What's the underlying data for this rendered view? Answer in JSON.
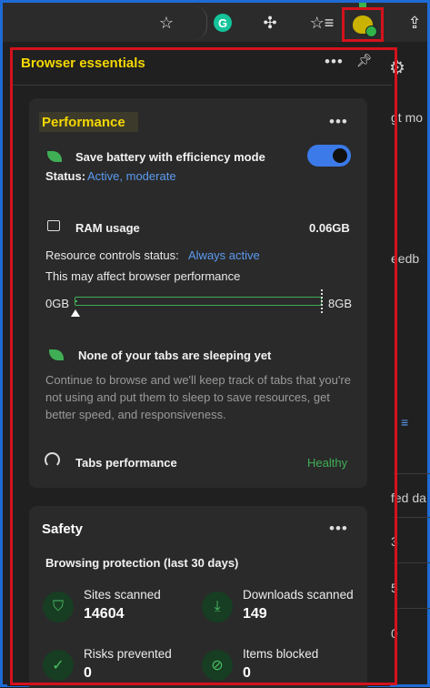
{
  "toolbar": {
    "icons": [
      "star-icon",
      "grammarly-icon",
      "extensions-icon",
      "favorites-icon",
      "browser-essentials-icon",
      "share-icon"
    ],
    "grammarly_letter": "G"
  },
  "background_page": {
    "fragments": [
      "gt mo",
      "eedb",
      "fed da",
      "3",
      "5",
      "0"
    ]
  },
  "panel": {
    "title": "Browser essentials",
    "menu_label": "•••",
    "pin_label": "⚲"
  },
  "performance": {
    "title": "Performance",
    "menu_label": "•••",
    "efficiency_label": "Save battery with efficiency mode",
    "status_label": "Status:",
    "status_value": "Active, moderate",
    "efficiency_toggle_on": true,
    "ram_label": "RAM usage",
    "ram_value": "0.06GB",
    "resource_status_label": "Resource controls status:",
    "resource_status_value": "Always active",
    "affect_text": "This may affect browser performance",
    "bar_min": "0GB",
    "bar_max": "8GB",
    "bar_fraction": 0.0075,
    "sleeping_title": "None of your tabs are sleeping yet",
    "sleeping_desc": "Continue to browse and we'll keep track of tabs that you're not using and put them to sleep to save resources, get better speed, and responsiveness.",
    "tabs_perf_label": "Tabs performance",
    "tabs_perf_value": "Healthy"
  },
  "safety": {
    "title": "Safety",
    "menu_label": "•••",
    "protection_label": "Browsing protection (last 30 days)",
    "stats": [
      {
        "label": "Sites scanned",
        "value": "14604",
        "icon": "shield-scan-icon"
      },
      {
        "label": "Downloads scanned",
        "value": "149",
        "icon": "download-icon"
      },
      {
        "label": "Risks prevented",
        "value": "0",
        "icon": "shield-check-icon"
      },
      {
        "label": "Items blocked",
        "value": "0",
        "icon": "blocked-file-icon"
      }
    ]
  },
  "colors": {
    "title_yellow": "#f5d800",
    "accent_blue": "#3b7ae8",
    "link_blue": "#5b9bf0",
    "healthy_green": "#3fae55",
    "highlight_red": "#d4121c"
  }
}
